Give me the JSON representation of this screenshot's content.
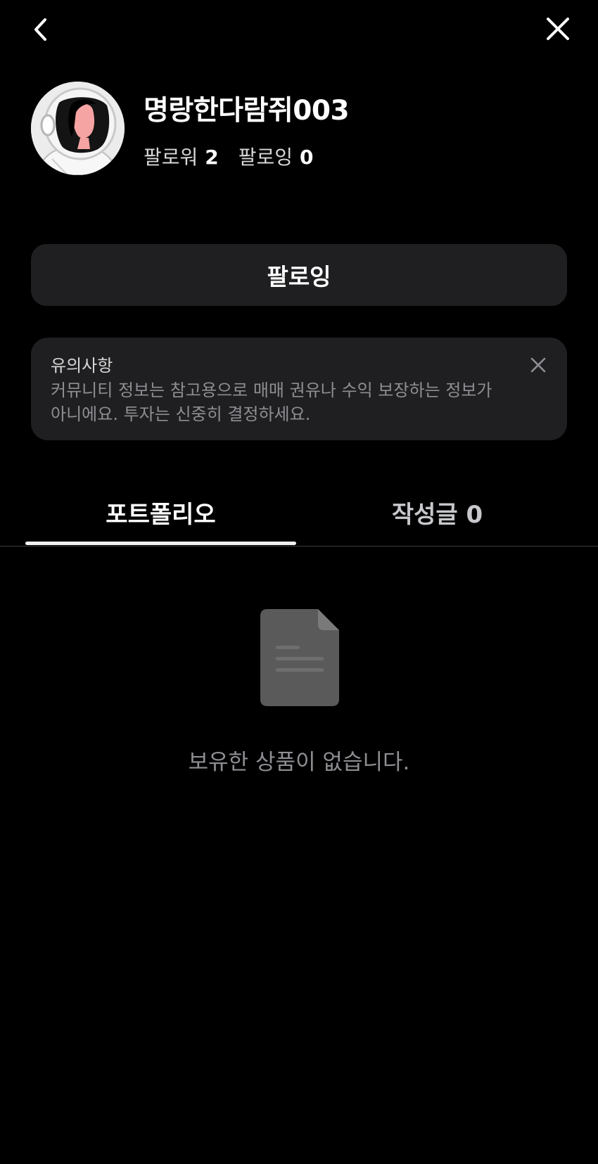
{
  "header": {
    "back_icon": "chevron-left-icon",
    "close_icon": "close-icon"
  },
  "profile": {
    "nickname": "명랑한다람쥐003",
    "avatar_icon": "astronaut-avatar",
    "followers_label": "팔로워",
    "followers_count": "2",
    "following_label": "팔로잉",
    "following_count": "0"
  },
  "follow_button": {
    "label": "팔로잉"
  },
  "notice": {
    "title": "유의사항",
    "body": "커뮤니티 정보는 참고용으로 매매 권유나 수익 보장하는 정보가 아니에요. 투자는 신중히 결정하세요."
  },
  "tabs": [
    {
      "label": "포트폴리오",
      "active": true
    },
    {
      "label": "작성글 0",
      "active": false
    }
  ],
  "empty_state": {
    "icon": "document-icon",
    "message": "보유한 상품이 없습니다."
  },
  "colors": {
    "background": "#000000",
    "card": "#1f1f21",
    "secondary_text": "#8e8e93",
    "divider": "#3a3a3c"
  }
}
